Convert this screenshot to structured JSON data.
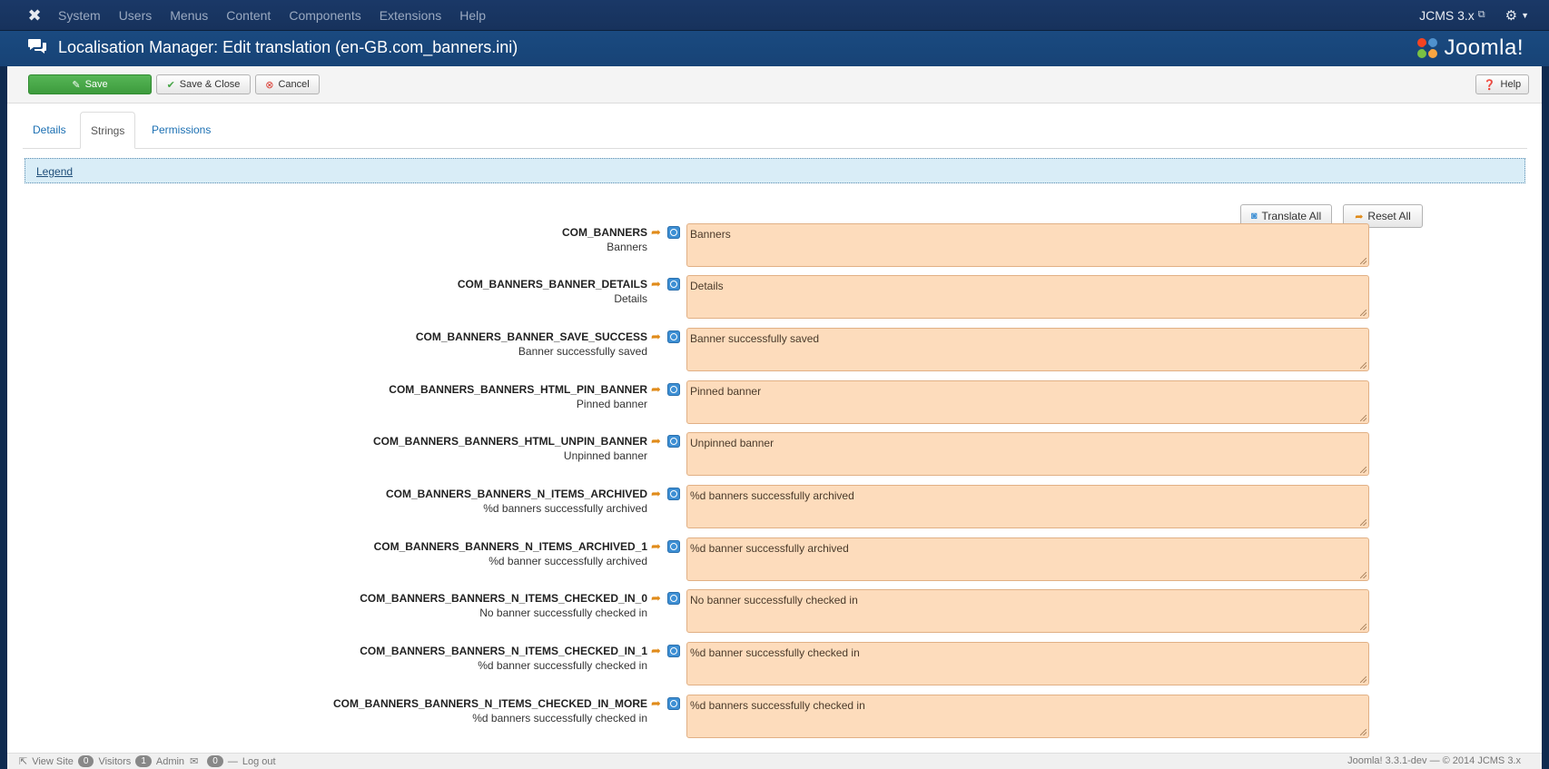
{
  "topnav": {
    "menu": [
      "System",
      "Users",
      "Menus",
      "Content",
      "Components",
      "Extensions",
      "Help"
    ],
    "site_name": "JCMS 3.x"
  },
  "header": {
    "title": "Localisation Manager: Edit translation (en-GB.com_banners.ini)",
    "brand": "Joomla!"
  },
  "toolbar": {
    "save_label": "Save",
    "save_close_label": "Save & Close",
    "cancel_label": "Cancel",
    "help_label": "Help"
  },
  "tabs": [
    {
      "label": "Details",
      "active": false
    },
    {
      "label": "Strings",
      "active": true
    },
    {
      "label": "Permissions",
      "active": false
    }
  ],
  "legend_label": "Legend",
  "actions": {
    "translate_all_label": "Translate All",
    "reset_all_label": "Reset All"
  },
  "strings": [
    {
      "key": "COM_BANNERS",
      "original": "Banners",
      "value": "Banners"
    },
    {
      "key": "COM_BANNERS_BANNER_DETAILS",
      "original": "Details",
      "value": "Details"
    },
    {
      "key": "COM_BANNERS_BANNER_SAVE_SUCCESS",
      "original": "Banner successfully saved",
      "value": "Banner successfully saved"
    },
    {
      "key": "COM_BANNERS_BANNERS_HTML_PIN_BANNER",
      "original": "Pinned banner",
      "value": "Pinned banner"
    },
    {
      "key": "COM_BANNERS_BANNERS_HTML_UNPIN_BANNER",
      "original": "Unpinned banner",
      "value": "Unpinned banner"
    },
    {
      "key": "COM_BANNERS_BANNERS_N_ITEMS_ARCHIVED",
      "original": "%d banners successfully archived",
      "value": "%d banners successfully archived"
    },
    {
      "key": "COM_BANNERS_BANNERS_N_ITEMS_ARCHIVED_1",
      "original": "%d banner successfully archived",
      "value": "%d banner successfully archived"
    },
    {
      "key": "COM_BANNERS_BANNERS_N_ITEMS_CHECKED_IN_0",
      "original": "No banner successfully checked in",
      "value": "No banner successfully checked in"
    },
    {
      "key": "COM_BANNERS_BANNERS_N_ITEMS_CHECKED_IN_1",
      "original": "%d banner successfully checked in",
      "value": "%d banner successfully checked in"
    },
    {
      "key": "COM_BANNERS_BANNERS_N_ITEMS_CHECKED_IN_MORE",
      "original": "%d banners successfully checked in",
      "value": "%d banners successfully checked in"
    }
  ],
  "statusbar": {
    "view_site": "View Site",
    "visitors_count": "0",
    "visitors_label": "Visitors",
    "admin_count": "1",
    "admin_label": "Admin",
    "messages_count": "0",
    "logout_label": "Log out",
    "version": "Joomla! 3.3.1-dev — © 2014 JCMS 3.x"
  },
  "colors": {
    "navbar_bg": "#17325c",
    "header_bg": "#174376",
    "save_green": "#46a546",
    "field_bg": "#fddcbc",
    "legend_bg": "#d9edf7",
    "link_blue": "#1c70b3"
  }
}
